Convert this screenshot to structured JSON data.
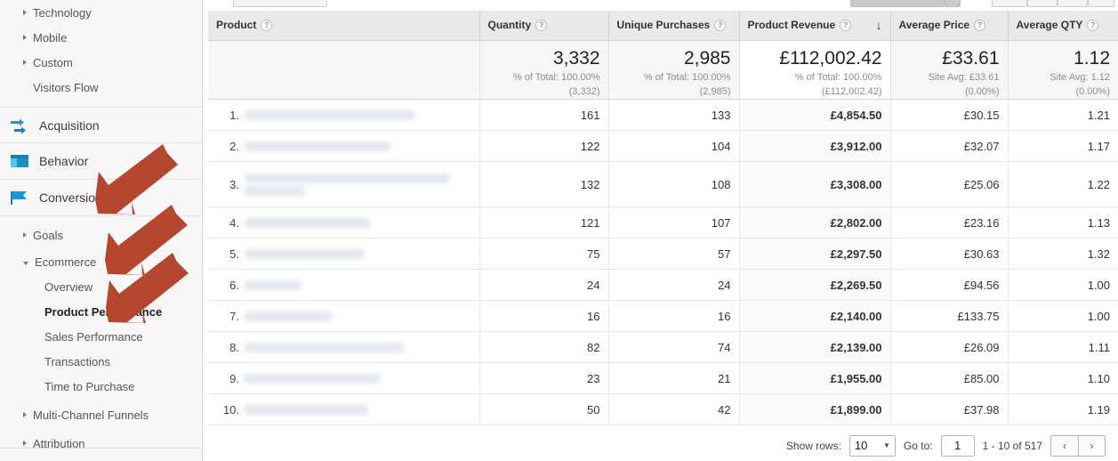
{
  "sidebar": {
    "top_items": [
      {
        "label": "Technology",
        "type": "expandable"
      },
      {
        "label": "Mobile",
        "type": "expandable"
      },
      {
        "label": "Custom",
        "type": "expandable"
      },
      {
        "label": "Visitors Flow",
        "type": "plain"
      }
    ],
    "sections": [
      {
        "label": "Acquisition",
        "icon": "acquisition-arrows-icon"
      },
      {
        "label": "Behavior",
        "icon": "behavior-window-icon"
      },
      {
        "label": "Conversions",
        "icon": "conversions-flag-icon"
      }
    ],
    "conversion_items": [
      {
        "label": "Goals",
        "type": "expandable",
        "expanded": false
      },
      {
        "label": "Ecommerce",
        "type": "expandable",
        "expanded": true
      }
    ],
    "ecommerce_children": [
      {
        "label": "Overview",
        "selected": false
      },
      {
        "label": "Product Performance",
        "selected": true
      },
      {
        "label": "Sales Performance",
        "selected": false
      },
      {
        "label": "Transactions",
        "selected": false
      },
      {
        "label": "Time to Purchase",
        "selected": false
      }
    ],
    "bottom_items": [
      {
        "label": "Multi-Channel Funnels",
        "type": "expandable"
      },
      {
        "label": "Attribution",
        "type": "expandable"
      }
    ]
  },
  "annotations": {
    "arrow_color": "#b5462f",
    "count": 3,
    "targets": [
      "Conversions",
      "Ecommerce",
      "Product Performance"
    ]
  },
  "table": {
    "columns": [
      {
        "key": "product",
        "label": "Product",
        "help": "?",
        "sorted": false
      },
      {
        "key": "quantity",
        "label": "Quantity",
        "help": "?",
        "sorted": false
      },
      {
        "key": "unique_purchases",
        "label": "Unique Purchases",
        "help": "?",
        "sorted": false
      },
      {
        "key": "product_revenue",
        "label": "Product Revenue",
        "help": "?",
        "sorted": true,
        "sort_dir": "desc",
        "sort_glyph": "↓"
      },
      {
        "key": "average_price",
        "label": "Average Price",
        "help": "?",
        "sorted": false
      },
      {
        "key": "average_qty",
        "label": "Average QTY",
        "help": "?",
        "sorted": false
      }
    ],
    "totals": {
      "quantity": {
        "value": "3,332",
        "line1": "% of Total: 100.00%",
        "line2": "(3,332)"
      },
      "unique_purchases": {
        "value": "2,985",
        "line1": "% of Total: 100.00%",
        "line2": "(2,985)"
      },
      "product_revenue": {
        "value": "£112,002.42",
        "line1": "% of Total: 100.00%",
        "line2": "(£112,002.42)"
      },
      "average_price": {
        "value": "£33.61",
        "line1": "Site Avg: £33.61",
        "line2": "(0.00%)"
      },
      "average_qty": {
        "value": "1.12",
        "line1": "Site Avg: 1.12",
        "line2": "(0.00%)"
      }
    },
    "rows": [
      {
        "index": "1.",
        "product": "[redacted]",
        "lines": 1,
        "quantity": "161",
        "unique_purchases": "133",
        "product_revenue": "£4,854.50",
        "average_price": "£30.15",
        "average_qty": "1.21"
      },
      {
        "index": "2.",
        "product": "[redacted]",
        "lines": 1,
        "quantity": "122",
        "unique_purchases": "104",
        "product_revenue": "£3,912.00",
        "average_price": "£32.07",
        "average_qty": "1.17"
      },
      {
        "index": "3.",
        "product": "[redacted]",
        "lines": 2,
        "quantity": "132",
        "unique_purchases": "108",
        "product_revenue": "£3,308.00",
        "average_price": "£25.06",
        "average_qty": "1.22"
      },
      {
        "index": "4.",
        "product": "[redacted]",
        "lines": 1,
        "quantity": "121",
        "unique_purchases": "107",
        "product_revenue": "£2,802.00",
        "average_price": "£23.16",
        "average_qty": "1.13"
      },
      {
        "index": "5.",
        "product": "[redacted]",
        "lines": 1,
        "quantity": "75",
        "unique_purchases": "57",
        "product_revenue": "£2,297.50",
        "average_price": "£30.63",
        "average_qty": "1.32"
      },
      {
        "index": "6.",
        "product": "[redacted]",
        "lines": 1,
        "quantity": "24",
        "unique_purchases": "24",
        "product_revenue": "£2,269.50",
        "average_price": "£94.56",
        "average_qty": "1.00"
      },
      {
        "index": "7.",
        "product": "[redacted]",
        "lines": 1,
        "quantity": "16",
        "unique_purchases": "16",
        "product_revenue": "£2,140.00",
        "average_price": "£133.75",
        "average_qty": "1.00"
      },
      {
        "index": "8.",
        "product": "[redacted]",
        "lines": 1,
        "quantity": "82",
        "unique_purchases": "74",
        "product_revenue": "£2,139.00",
        "average_price": "£26.09",
        "average_qty": "1.11"
      },
      {
        "index": "9.",
        "product": "[redacted]",
        "lines": 1,
        "quantity": "23",
        "unique_purchases": "21",
        "product_revenue": "£1,955.00",
        "average_price": "£85.00",
        "average_qty": "1.10"
      },
      {
        "index": "10.",
        "product": "[redacted]",
        "lines": 1,
        "quantity": "50",
        "unique_purchases": "42",
        "product_revenue": "£1,899.00",
        "average_price": "£37.98",
        "average_qty": "1.19"
      }
    ]
  },
  "footer": {
    "show_rows_label": "Show rows:",
    "rows_per_page": "10",
    "goto_label": "Go to:",
    "goto_value": "1",
    "range_text": "1 - 10 of 517",
    "prev_glyph": "‹",
    "next_glyph": "›"
  }
}
